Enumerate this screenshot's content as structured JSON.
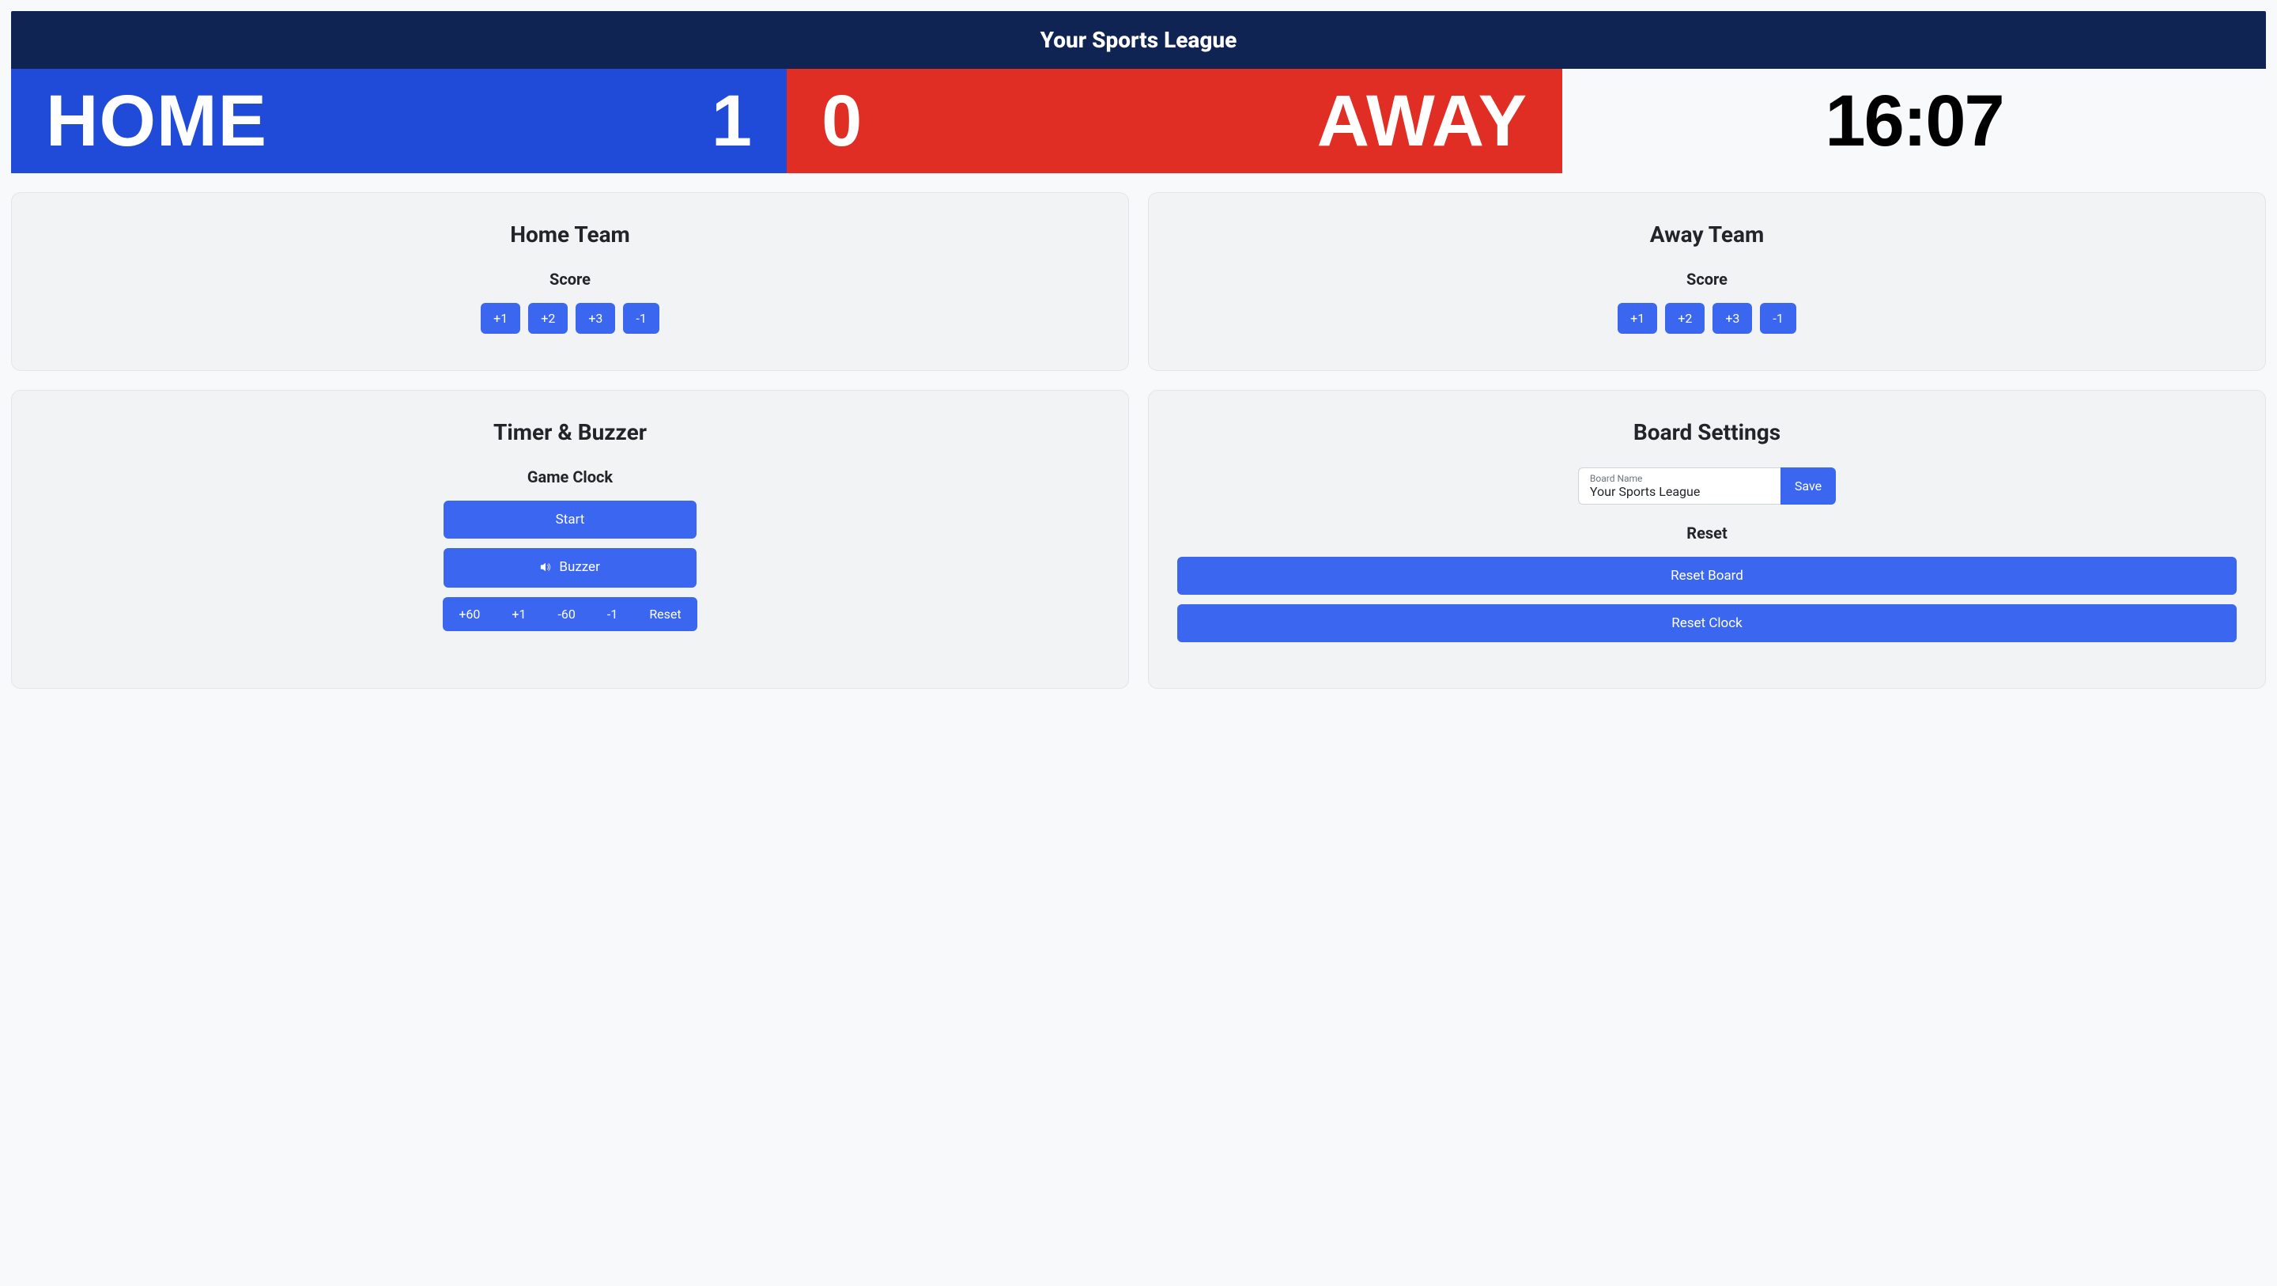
{
  "league": {
    "title": "Your Sports League"
  },
  "score": {
    "home_name": "HOME",
    "home_score": "1",
    "away_name": "AWAY",
    "away_score": "0",
    "game_clock": "16:07"
  },
  "home_team_card": {
    "title": "Home Team",
    "score_label": "Score",
    "buttons": {
      "plus1": "+1",
      "plus2": "+2",
      "plus3": "+3",
      "minus1": "-1"
    }
  },
  "away_team_card": {
    "title": "Away Team",
    "score_label": "Score",
    "buttons": {
      "plus1": "+1",
      "plus2": "+2",
      "plus3": "+3",
      "minus1": "-1"
    }
  },
  "timer_card": {
    "title": "Timer & Buzzer",
    "game_clock_label": "Game Clock",
    "start": "Start",
    "buzzer": "Buzzer",
    "adjust": {
      "plus60": "+60",
      "plus1": "+1",
      "minus60": "-60",
      "minus1": "-1",
      "reset": "Reset"
    }
  },
  "board_card": {
    "title": "Board Settings",
    "name_label": "Board Name",
    "name_value": "Your Sports League",
    "save": "Save",
    "reset_label": "Reset",
    "reset_board": "Reset Board",
    "reset_clock": "Reset Clock"
  }
}
